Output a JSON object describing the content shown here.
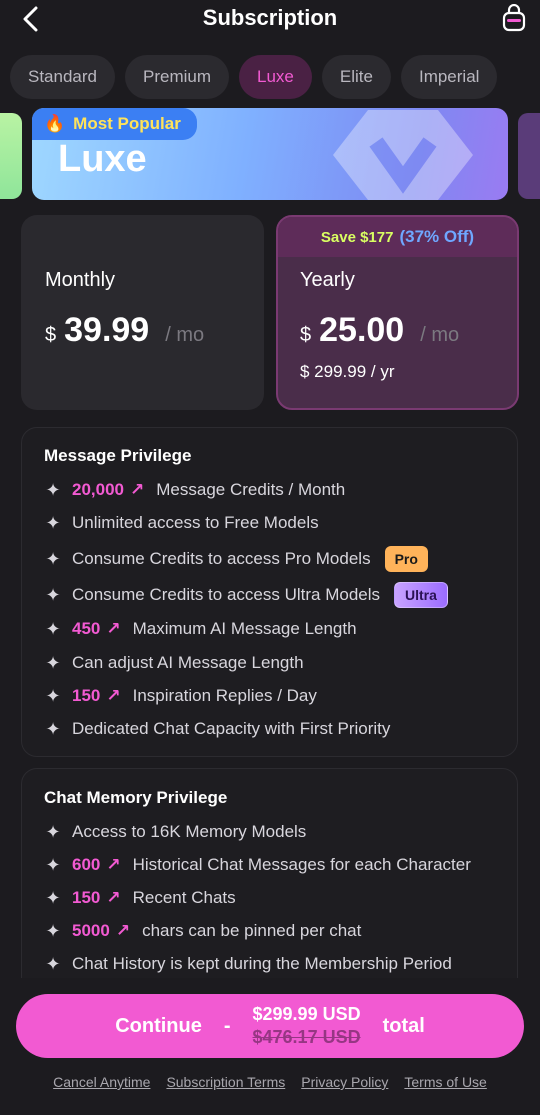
{
  "header": {
    "title": "Subscription",
    "back_icon": "chevron-left-icon",
    "bag_icon": "shopping-bag-icon"
  },
  "tabs": [
    {
      "label": "Standard",
      "active": false
    },
    {
      "label": "Premium",
      "active": false
    },
    {
      "label": "Luxe",
      "active": true
    },
    {
      "label": "Elite",
      "active": false
    },
    {
      "label": "Imperial",
      "active": false
    }
  ],
  "banner": {
    "tag": "Most Popular",
    "tag_icon": "fire-icon",
    "name": "Luxe"
  },
  "plans": {
    "monthly": {
      "label": "Monthly",
      "currency": "$",
      "amount": "39.99",
      "per": "/ mo"
    },
    "yearly": {
      "save_text": "Save $177",
      "off_text": "(37% Off)",
      "label": "Yearly",
      "currency": "$",
      "amount": "25.00",
      "per": "/ mo",
      "total": "$ 299.99 / yr",
      "selected": true
    }
  },
  "message_privilege": {
    "title": "Message Privilege",
    "items": [
      {
        "highlight": "20,000",
        "text": "Message Credits / Month"
      },
      {
        "text": "Unlimited access to Free Models"
      },
      {
        "text": "Consume Credits to access Pro Models",
        "badge": "Pro"
      },
      {
        "text": "Consume Credits to access Ultra Models",
        "badge": "Ultra"
      },
      {
        "highlight": "450",
        "text": "Maximum AI Message Length"
      },
      {
        "text": "Can adjust AI Message Length"
      },
      {
        "highlight": "150",
        "text": "Inspiration Replies / Day"
      },
      {
        "text": "Dedicated Chat Capacity with First Priority"
      }
    ]
  },
  "chat_memory_privilege": {
    "title": "Chat Memory Privilege",
    "items": [
      {
        "text": "Access to 16K Memory Models"
      },
      {
        "highlight": "600",
        "text": "Historical Chat Messages for each Character"
      },
      {
        "highlight": "150",
        "text": "Recent Chats"
      },
      {
        "highlight": "5000",
        "text": "chars can be pinned per chat"
      },
      {
        "text": "Chat History is kept during the Membership Period"
      }
    ]
  },
  "continue_button": {
    "label": "Continue",
    "dash": "-",
    "price": "$299.99 USD",
    "original_price": "$476.17 USD",
    "suffix": "total"
  },
  "footer": {
    "cancel": "Cancel Anytime",
    "terms": "Subscription Terms",
    "privacy": "Privacy Policy",
    "terms_of_use": "Terms of Use"
  },
  "colors": {
    "accent": "#f25ad2",
    "background": "#1c1b1f",
    "save_green": "#d9ff62",
    "save_blue": "#6fa7ff"
  }
}
